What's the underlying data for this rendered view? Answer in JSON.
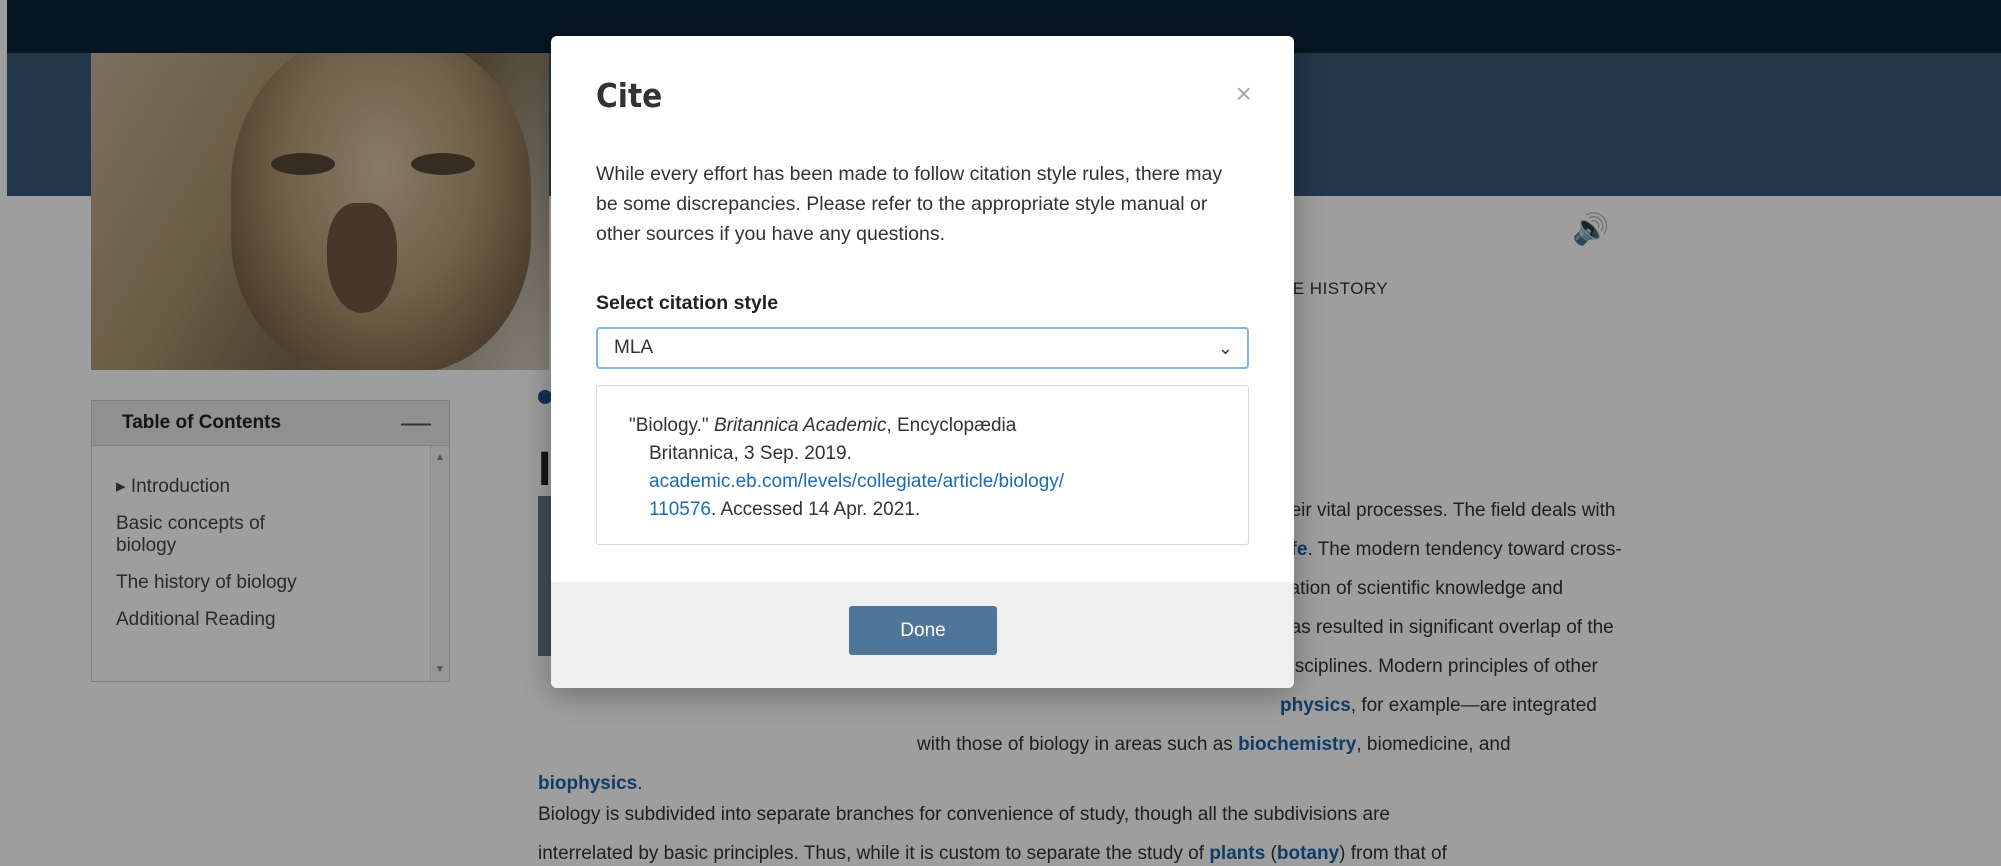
{
  "toolbar": {
    "icons": [
      {
        "name": "star-icon",
        "glyph": "☆"
      },
      {
        "name": "print-icon",
        "glyph": "⎙"
      },
      {
        "name": "checkbox-icon",
        "glyph": "☑"
      },
      {
        "name": "globe-icon",
        "glyph": "⊕"
      },
      {
        "name": "speaker-icon",
        "glyph": "🔊"
      },
      {
        "name": "plus-icon",
        "glyph": "+"
      },
      {
        "name": "minus-icon",
        "glyph": "—"
      }
    ]
  },
  "article_tab": "CLE HISTORY",
  "toc": {
    "title": "Table of Contents",
    "collapse_glyph": "—",
    "items": [
      {
        "label": "▸ Introduction"
      },
      {
        "label": "Basic concepts of biology"
      },
      {
        "label": "The history of biology"
      },
      {
        "label": "Additional Reading"
      }
    ]
  },
  "heading_fragment": "I",
  "article": {
    "line1": "heir vital processes. The field deals with",
    "line2_kw": "life",
    "line2_rest": ". The modern tendency toward cross-",
    "line3": "cation of scientific knowledge and",
    "line4": "has resulted in significant overlap of the",
    "line5": "disciplines. Modern principles of other",
    "line6_kw": "physics",
    "line6_rest": ", for example—are integrated",
    "line7_pre": "with those of biology in areas such as ",
    "line7_kw": "biochemistry",
    "line7_rest": ", biomedicine, and",
    "line8_kw": "biophysics",
    "line8_rest": ".",
    "para2_line1": "Biology is subdivided into separate branches for convenience of study, though all the subdivisions are",
    "para2_line2_pre": "interrelated by basic principles. Thus, while it is custom to separate the study of ",
    "para2_kw1": "plants",
    "para2_mid": " (",
    "para2_kw2": "botany",
    "para2_line2_rest": ") from that of"
  },
  "modal": {
    "title": "Cite",
    "close_glyph": "×",
    "disclaimer": "While every effort has been made to follow citation style rules, there may be some discrepancies. Please refer to the appropriate style manual or other sources if you have any questions.",
    "select_label": "Select citation style",
    "select_value": "MLA",
    "select_chevron": "⌄",
    "citation": {
      "part1": "\"Biology.\" ",
      "source": "Britannica Academic",
      "part2": ", Encyclopædia",
      "line2": "Britannica, 3 Sep. 2019.",
      "url1": "academic.eb.com/levels/collegiate/article/biology/",
      "url2": "110576",
      "accessed": ". Accessed 14 Apr. 2021."
    },
    "done_label": "Done"
  },
  "colors": {
    "nav": "#0e2438",
    "header": "#3a5876",
    "link": "#1d6bb0",
    "done_button": "#4f7599",
    "select_focus": "#7fb6e6"
  }
}
